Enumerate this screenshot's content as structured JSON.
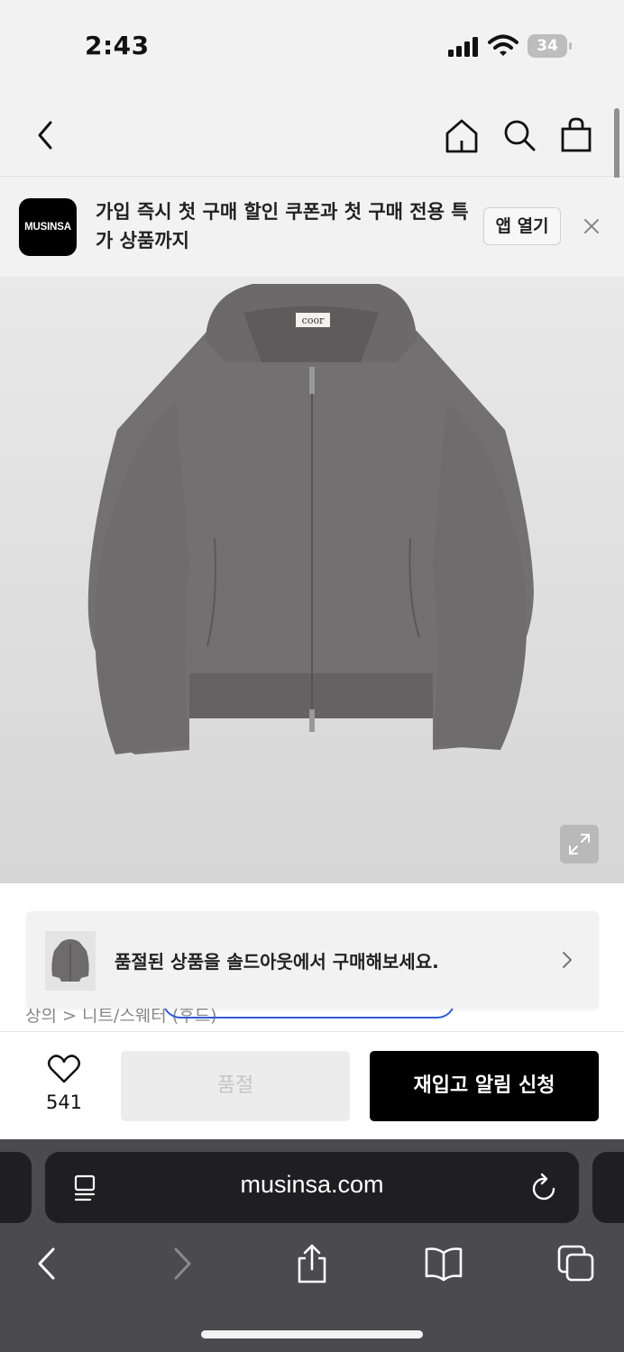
{
  "status_bar": {
    "time": "2:43",
    "battery_level": "34"
  },
  "nav": {
    "icons": [
      "back-icon",
      "home-icon",
      "search-icon",
      "shopping-bag-icon"
    ]
  },
  "app_banner": {
    "logo_text": "MUSINSA",
    "message": "가입 즉시 첫 구매 할인 쿠폰과 첫 구매 전용 특가 상품까지",
    "open_app_label": "앱 열기"
  },
  "product": {
    "label_tag": "coor"
  },
  "content": {
    "breadcrumb": "상의 > 니트/스웨터 (후드)"
  },
  "toast": {
    "message": "품절된 상품을 솔드아웃에서 구매해보세요."
  },
  "action_bar": {
    "like_count": "541",
    "soldout_label": "품절",
    "restock_label": "재입고 알림 신청"
  },
  "browser": {
    "url": "musinsa.com",
    "toolbar_icons": [
      "back-icon",
      "forward-icon",
      "share-icon",
      "bookmarks-icon",
      "tabs-icon"
    ]
  },
  "colors": {
    "background": "#f2f2f2",
    "primary_button": "#000000",
    "disabled_button": "#ececec",
    "browser_chrome": "#4b4b4f",
    "address_bar": "#1f1f21",
    "accent_line": "#2f5bd8"
  }
}
